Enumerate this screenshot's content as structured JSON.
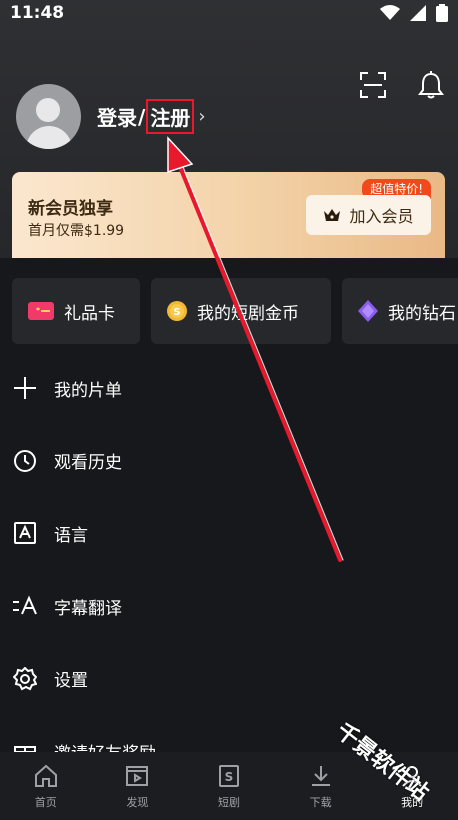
{
  "status_bar": {
    "time": "11:48"
  },
  "profile": {
    "login": "登录",
    "slash": "/",
    "register": "注册",
    "chevron": "›"
  },
  "vip": {
    "title": "新会员独享",
    "subtitle": "首月仅需$1.99",
    "badge": "超值特价!",
    "join_label": "加入会员"
  },
  "quick_cards": [
    {
      "label": "礼品卡",
      "icon": "gift-card-icon"
    },
    {
      "label": "我的短剧金币",
      "icon": "coin-icon"
    },
    {
      "label": "我的钻石",
      "icon": "diamond-icon"
    }
  ],
  "menu": [
    {
      "label": "我的片单",
      "icon": "plus-icon"
    },
    {
      "label": "观看历史",
      "icon": "clock-icon"
    },
    {
      "label": "语言",
      "icon": "language-icon"
    },
    {
      "label": "字幕翻译",
      "icon": "subtitle-icon"
    },
    {
      "label": "设置",
      "icon": "gear-icon"
    },
    {
      "label": "邀请好友奖励",
      "icon": "gift-icon"
    }
  ],
  "nav": [
    {
      "label": "首页",
      "icon": "home-icon"
    },
    {
      "label": "发现",
      "icon": "play-icon"
    },
    {
      "label": "短剧",
      "icon": "drama-icon"
    },
    {
      "label": "下载",
      "icon": "download-icon"
    },
    {
      "label": "我的",
      "icon": "profile-icon"
    }
  ],
  "watermark": "千景软件站",
  "colors": {
    "accent_red": "#e8192c",
    "vip_gold": "#f3d2a8",
    "badge_orange": "#f04a1c"
  }
}
